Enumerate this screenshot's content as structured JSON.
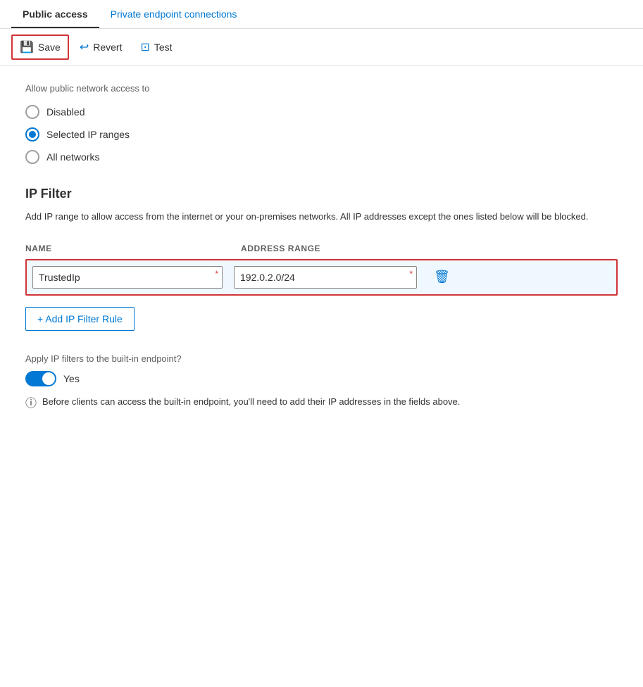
{
  "tabs": [
    {
      "id": "public-access",
      "label": "Public access",
      "active": true
    },
    {
      "id": "private-endpoint",
      "label": "Private endpoint connections",
      "active": false
    }
  ],
  "toolbar": {
    "save_label": "Save",
    "revert_label": "Revert",
    "test_label": "Test"
  },
  "network_access": {
    "label": "Allow public network access to",
    "options": [
      {
        "id": "disabled",
        "label": "Disabled",
        "checked": false
      },
      {
        "id": "selected-ip-ranges",
        "label": "Selected IP ranges",
        "checked": true
      },
      {
        "id": "all-networks",
        "label": "All networks",
        "checked": false
      }
    ]
  },
  "ip_filter": {
    "title": "IP Filter",
    "description": "Add IP range to allow access from the internet or your on-premises networks. All IP addresses except the ones listed below will be blocked.",
    "columns": {
      "name": "NAME",
      "address_range": "ADDRESS RANGE"
    },
    "rows": [
      {
        "name": "TrustedIp",
        "address_range": "192.0.2.0/24",
        "name_placeholder": "",
        "range_placeholder": ""
      }
    ],
    "add_rule_label": "+ Add IP Filter Rule"
  },
  "built_in_endpoint": {
    "question": "Apply IP filters to the built-in endpoint?",
    "toggle_value": "Yes",
    "toggle_on": true,
    "info_text": "Before clients can access the built-in endpoint, you'll need to add their IP addresses in the fields above."
  },
  "icons": {
    "save": "💾",
    "revert": "↩",
    "test": "🧪",
    "delete": "🗑",
    "plus": "+",
    "info": "ⓘ"
  }
}
